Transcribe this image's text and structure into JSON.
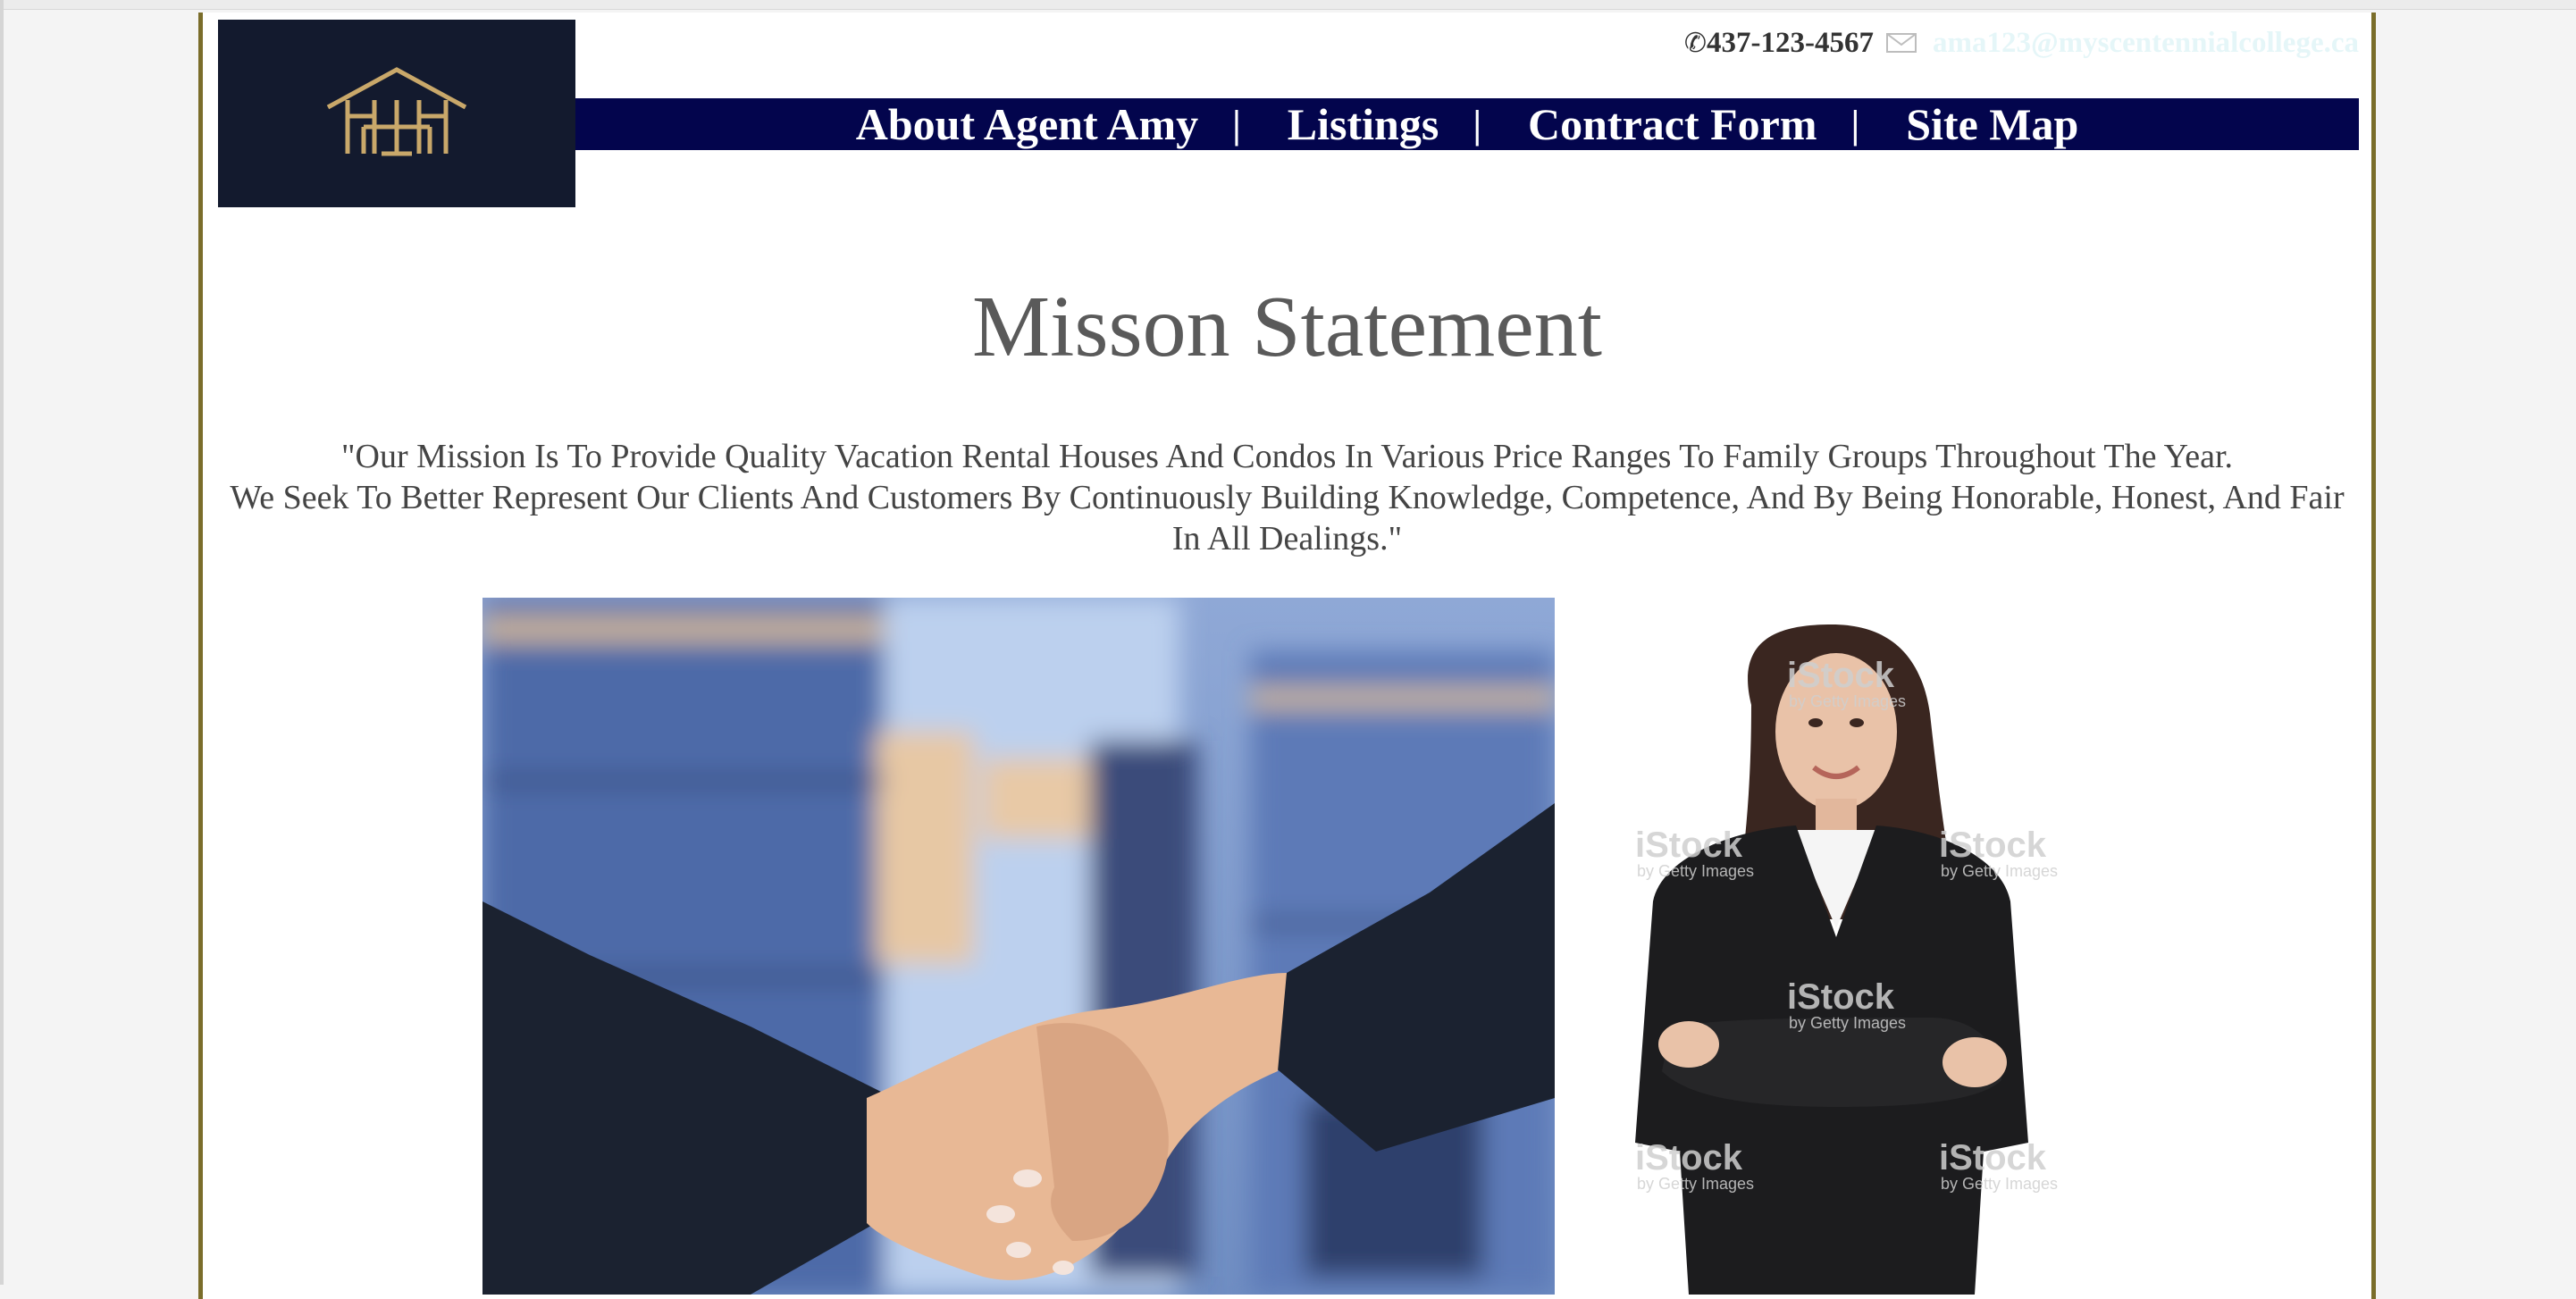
{
  "header": {
    "logo_alt": "House logo",
    "phone": "437-123-4567",
    "phone_icon": "phone-icon",
    "mail_icon": "envelope-icon",
    "email": "ama123@myscentennialcollege.ca"
  },
  "nav": {
    "items": [
      {
        "label": "About Agent Amy"
      },
      {
        "label": "Listings"
      },
      {
        "label": "Contract Form"
      },
      {
        "label": "Site Map"
      }
    ],
    "separator": "|"
  },
  "main": {
    "title": "Misson Statement",
    "mission_lines": [
      "\"Our Mission Is To Provide Quality Vacation Rental Houses And Condos In Various Price Ranges To Family Groups Throughout The Year.",
      "We Seek To Better Represent Our Clients And Customers By Continuously Building Knowledge, Competence, And By Being Honorable, Honest, And Fair In All Dealings.\""
    ],
    "watermark": "iStock",
    "watermark_sub": "by Getty Images"
  },
  "colors": {
    "logo_bg": "#131a2e",
    "logo_gold": "#c9a86a",
    "nav_bg": "#03054d",
    "border_gold": "#7a6d2a",
    "text_gray": "#5a5a5a"
  }
}
